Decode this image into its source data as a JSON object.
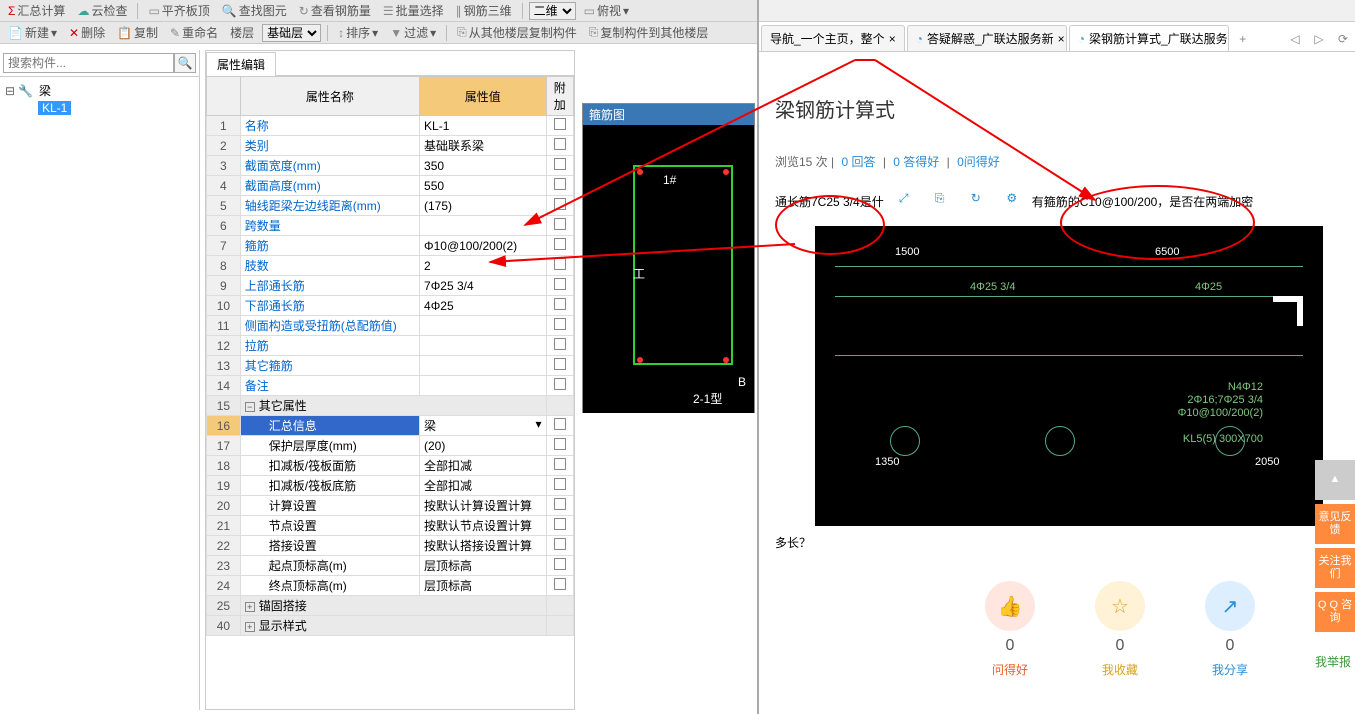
{
  "toolbar1": {
    "sum": "汇总计算",
    "cloud": "云检查",
    "flat": "平齐板顶",
    "find": "查找图元",
    "check_rebar": "查看钢筋量",
    "batch": "批量选择",
    "rebar3d": "钢筋三维",
    "view2d": "二维",
    "view_top": "俯视"
  },
  "toolbar2": {
    "new": "新建",
    "del": "删除",
    "copy": "复制",
    "rename": "重命名",
    "floor": "楼层",
    "base_layer": "基础层",
    "sort": "排序",
    "filter": "过滤",
    "copy_from": "从其他楼层复制构件",
    "copy_to": "复制构件到其他楼层"
  },
  "search_placeholder": "搜索构件...",
  "tree": {
    "root": "梁",
    "child": "KL-1"
  },
  "prop_tab": "属性编辑",
  "prop_headers": {
    "name": "属性名称",
    "value": "属性值",
    "extra": "附加"
  },
  "props": [
    {
      "n": "1",
      "name": "名称",
      "val": "KL-1"
    },
    {
      "n": "2",
      "name": "类别",
      "val": "基础联系梁"
    },
    {
      "n": "3",
      "name": "截面宽度(mm)",
      "val": "350"
    },
    {
      "n": "4",
      "name": "截面高度(mm)",
      "val": "550"
    },
    {
      "n": "5",
      "name": "轴线距梁左边线距离(mm)",
      "val": "(175)"
    },
    {
      "n": "6",
      "name": "跨数量",
      "val": ""
    },
    {
      "n": "7",
      "name": "箍筋",
      "val": "Φ10@100/200(2)"
    },
    {
      "n": "8",
      "name": "肢数",
      "val": "2"
    },
    {
      "n": "9",
      "name": "上部通长筋",
      "val": "7Φ25 3/4"
    },
    {
      "n": "10",
      "name": "下部通长筋",
      "val": "4Φ25"
    },
    {
      "n": "11",
      "name": "侧面构造或受扭筋(总配筋值)",
      "val": ""
    },
    {
      "n": "12",
      "name": "拉筋",
      "val": ""
    },
    {
      "n": "13",
      "name": "其它箍筋",
      "val": ""
    },
    {
      "n": "14",
      "name": "备注",
      "val": ""
    }
  ],
  "prop_groups": {
    "g15": {
      "n": "15",
      "name": "其它属性"
    },
    "g16": {
      "n": "16",
      "name": "汇总信息",
      "val": "梁"
    },
    "p17": {
      "n": "17",
      "name": "保护层厚度(mm)",
      "val": "(20)"
    },
    "p18": {
      "n": "18",
      "name": "扣减板/筏板面筋",
      "val": "全部扣减"
    },
    "p19": {
      "n": "19",
      "name": "扣减板/筏板底筋",
      "val": "全部扣减"
    },
    "p20": {
      "n": "20",
      "name": "计算设置",
      "val": "按默认计算设置计算"
    },
    "p21": {
      "n": "21",
      "name": "节点设置",
      "val": "按默认节点设置计算"
    },
    "p22": {
      "n": "22",
      "name": "搭接设置",
      "val": "按默认搭接设置计算"
    },
    "p23": {
      "n": "23",
      "name": "起点顶标高(m)",
      "val": "层顶标高"
    },
    "p24": {
      "n": "24",
      "name": "终点顶标高(m)",
      "val": "层顶标高"
    },
    "g25": {
      "n": "25",
      "name": "锚固搭接"
    },
    "g40": {
      "n": "40",
      "name": "显示样式"
    }
  },
  "stirrup_title": "箍筋图",
  "stirrup_labels": {
    "a": "1#",
    "b": "B",
    "c": "2-1型"
  },
  "tabs": {
    "t1": "导航_一个主页，整个",
    "t2": "答疑解惑_广联达服务新",
    "t3": "梁钢筋计算式_广联达服务"
  },
  "page": {
    "title": "梁钢筋计算式",
    "stats_views": "浏览15 次",
    "stats_reply": "0 回答",
    "stats_good": "0 答得好",
    "stats_ask": "0问得好",
    "q_left": "通长筋7C25 3/4是什",
    "q_right": "有箍筋的C10@100/200，是否在两端加密",
    "q_tail": "多长？",
    "drawing": {
      "d1": "1500",
      "d2": "6500",
      "d3": "1350",
      "d4": "2050",
      "n1": "N4Φ12",
      "n2": "2Φ16;7Φ25 3/4",
      "n3": "Φ10@100/200(2)",
      "n4": "KL5(5) 300X700",
      "n5": "4Φ25",
      "n6": "4Φ25 3/4"
    }
  },
  "votes": {
    "v1": {
      "num": "0",
      "txt": "问得好"
    },
    "v2": {
      "num": "0",
      "txt": "我收藏"
    },
    "v3": {
      "num": "0",
      "txt": "我分享"
    },
    "v4": {
      "txt": "我举报"
    }
  },
  "side": {
    "top": "▲",
    "s1": "意见反馈",
    "s2": "关注我们",
    "s3": "Q Q 咨询"
  }
}
